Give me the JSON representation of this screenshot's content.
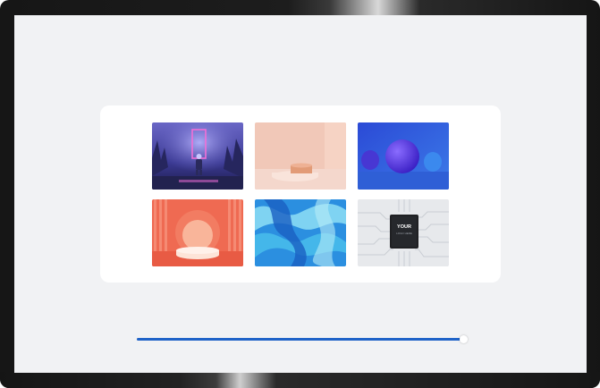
{
  "gallery": {
    "thumbnails": [
      {
        "icon": "neon-portal-astronaut-image"
      },
      {
        "icon": "peach-podium-image"
      },
      {
        "icon": "blue-spheres-image"
      },
      {
        "icon": "coral-arch-podium-image"
      },
      {
        "icon": "blue-fluid-marble-image"
      },
      {
        "icon": "microchip-circuit-image",
        "chip_title": "YOUR",
        "chip_subtitle": "LOGO HERE"
      }
    ]
  },
  "progress": {
    "fraction": 0.99,
    "fill_color": "#1f63c8"
  },
  "colors": {
    "screen_background": "#f1f2f4",
    "panel_background": "#ffffff",
    "device_bezel": "#1a1a1a"
  }
}
